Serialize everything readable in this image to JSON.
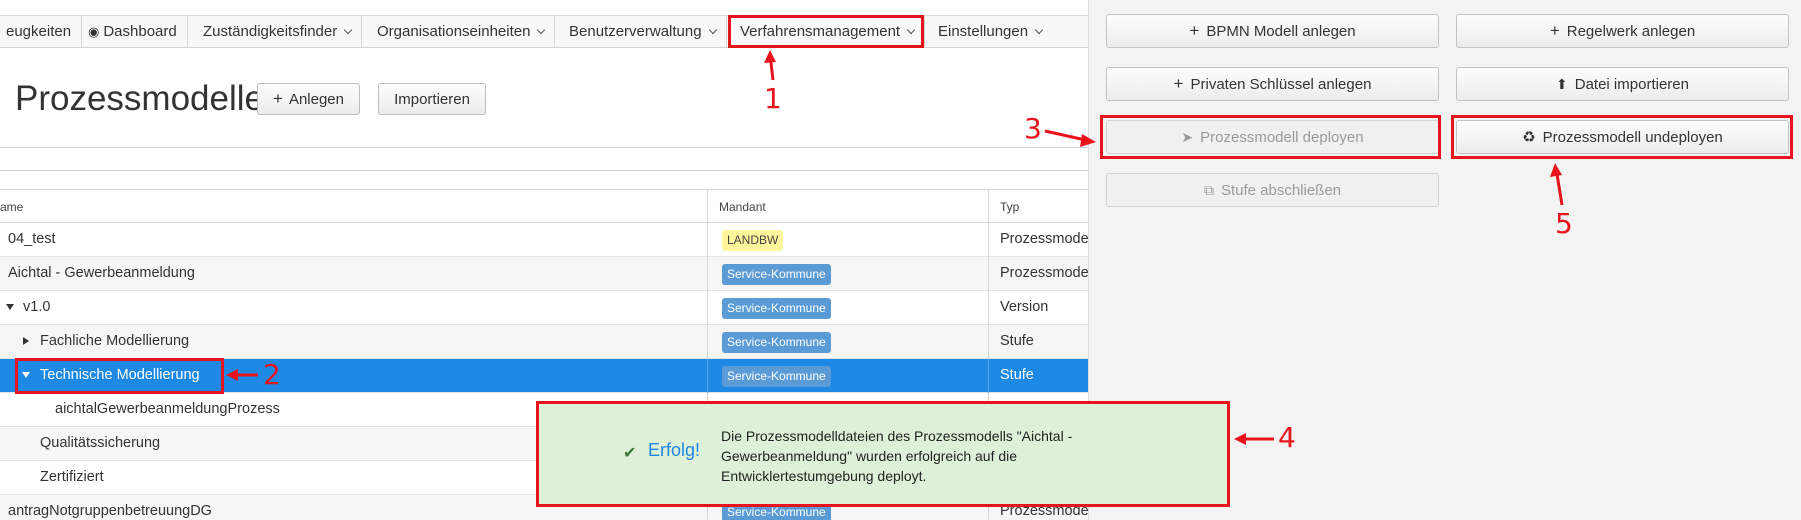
{
  "nav": {
    "items": [
      {
        "label": "eugkeiten"
      },
      {
        "label": "Dashboard"
      },
      {
        "label": "Zuständigkeitsfinder"
      },
      {
        "label": "Organisationseinheiten"
      },
      {
        "label": "Benutzerverwaltung"
      },
      {
        "label": "Verfahrensmanagement"
      },
      {
        "label": "Einstellungen"
      }
    ]
  },
  "page": {
    "title": "Prozessmodelle",
    "create_label": "Anlegen",
    "import_label": "Importieren"
  },
  "table": {
    "headers": {
      "name": "ame",
      "mandant": "Mandant",
      "typ": "Typ"
    },
    "rows": [
      {
        "name": "04_test",
        "mandant": "LANDBW",
        "typ": "Prozessmode"
      },
      {
        "name": "Aichtal - Gewerbeanmeldung",
        "mandant": "Service-Kommune",
        "typ": "Prozessmode"
      },
      {
        "name": "v1.0",
        "mandant": "Service-Kommune",
        "typ": "Version"
      },
      {
        "name": "Fachliche Modellierung",
        "mandant": "Service-Kommune",
        "typ": "Stufe"
      },
      {
        "name": "Technische Modellierung",
        "mandant": "Service-Kommune",
        "typ": "Stufe"
      },
      {
        "name": "aichtalGewerbeanmeldungProzess",
        "mandant": "",
        "typ": ""
      },
      {
        "name": "Qualitätssicherung",
        "mandant": "",
        "typ": ""
      },
      {
        "name": "Zertifiziert",
        "mandant": "",
        "typ": ""
      },
      {
        "name": "antragNotgruppenbetreuungDG",
        "mandant": "Service-Kommune",
        "typ": "Prozessmode"
      }
    ]
  },
  "panel": {
    "bpmn_label": "BPMN Modell anlegen",
    "regelwerk_label": "Regelwerk anlegen",
    "key_label": "Privaten Schlüssel anlegen",
    "file_import_label": "Datei importieren",
    "deploy_label": "Prozessmodell deployen",
    "undeploy_label": "Prozessmodell undeployen",
    "stage_close_label": "Stufe abschließen"
  },
  "toast": {
    "title": "Erfolg!",
    "message": "Die Prozessmodelldateien des Prozessmodells \"Aichtal - Gewerbeanmeldung\" wurden erfolgreich auf die Entwicklertestumgebung deployt."
  },
  "annotations": [
    "1",
    "2",
    "3",
    "4",
    "5"
  ],
  "colors": {
    "annotation_red": "#e8141b",
    "selected_row": "#1e88e5",
    "badge_blue": "#5b9bd5",
    "badge_yellow": "#fff59d",
    "toast_bg": "#dff0d8"
  }
}
